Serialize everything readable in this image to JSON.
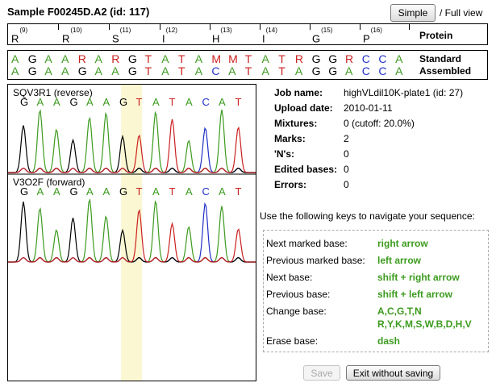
{
  "header": {
    "title": "Sample F00245D.A2 (id: 117)",
    "simple_label": "Simple",
    "fullview_label": "/ Full view"
  },
  "protein": {
    "label": "Protein",
    "residues": [
      {
        "aa": "R",
        "num": "(9)"
      },
      {
        "aa": "R",
        "num": "(10)"
      },
      {
        "aa": "S",
        "num": "(11)"
      },
      {
        "aa": "I",
        "num": "(12)"
      },
      {
        "aa": "H",
        "num": "(13)"
      },
      {
        "aa": "I",
        "num": "(14)"
      },
      {
        "aa": "G",
        "num": "(15)"
      },
      {
        "aa": "P",
        "num": "(16)"
      }
    ]
  },
  "sequence": {
    "standard_label": "Standard",
    "assembled_label": "Assembled",
    "standard": [
      "A",
      "G",
      "A",
      "A",
      "R",
      "A",
      "R",
      "G",
      "T",
      "A",
      "T",
      "A",
      "M",
      "M",
      "T",
      "A",
      "T",
      "R",
      "G",
      "G",
      "R",
      "C",
      "C",
      "A"
    ],
    "assembled": [
      "A",
      "G",
      "A",
      "A",
      "G",
      "A",
      "A",
      "G",
      "T",
      "A",
      "T",
      "A",
      "C",
      "A",
      "T",
      "A",
      "T",
      "A",
      "G",
      "G",
      "A",
      "C",
      "C",
      "A"
    ],
    "colors": {
      "A": "#3c9b1e",
      "G": "#000000",
      "T": "#cc2020",
      "C": "#2030c8",
      "R": "#cc2020",
      "M": "#cc2020"
    }
  },
  "chromatograms": [
    {
      "label": "SQV3R1 (reverse)",
      "bases": [
        "G",
        "A",
        "A",
        "G",
        "A",
        "A",
        "G",
        "T",
        "A",
        "T",
        "A",
        "C",
        "A",
        "T"
      ]
    },
    {
      "label": "V3O2F (forward)",
      "bases": [
        "G",
        "A",
        "A",
        "G",
        "A",
        "A",
        "G",
        "T",
        "A",
        "T",
        "A",
        "C",
        "A",
        "T"
      ]
    }
  ],
  "info": [
    {
      "key": "Job name:",
      "value": "highVLdil10K-plate1 (id: 27)"
    },
    {
      "key": "Upload date:",
      "value": "2010-01-11"
    },
    {
      "key": "Mixtures:",
      "value": "0 (cutoff: 20.0%)"
    },
    {
      "key": "Marks:",
      "value": "2"
    },
    {
      "key": "'N's:",
      "value": "0"
    },
    {
      "key": "Edited bases:",
      "value": "0"
    },
    {
      "key": "Errors:",
      "value": "0"
    }
  ],
  "nav_intro": "Use the following keys to navigate your sequence:",
  "keys": [
    {
      "name": "Next marked base:",
      "key": "right arrow"
    },
    {
      "name": "Previous marked base:",
      "key": "left arrow"
    },
    {
      "name": "Next base:",
      "key": "shift + right arrow"
    },
    {
      "name": "Previous base:",
      "key": "shift + left arrow"
    },
    {
      "name": "Change base:",
      "key": "A,C,G,T,N",
      "key2": "R,Y,K,M,S,W,B,D,H,V"
    },
    {
      "name": "Erase base:",
      "key": "dash"
    }
  ],
  "buttons": {
    "save_label": "Save",
    "exit_label": "Exit without saving"
  }
}
